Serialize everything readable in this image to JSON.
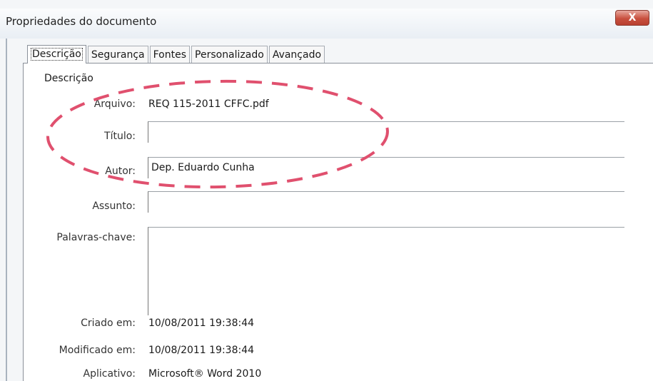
{
  "window": {
    "title": "Propriedades do documento",
    "close_label": "X"
  },
  "tabs": [
    {
      "label": "Descrição",
      "active": true
    },
    {
      "label": "Segurança",
      "active": false
    },
    {
      "label": "Fontes",
      "active": false
    },
    {
      "label": "Personalizado",
      "active": false
    },
    {
      "label": "Avançado",
      "active": false
    }
  ],
  "description": {
    "section_label": "Descrição",
    "fields": {
      "arquivo": {
        "label": "Arquivo:",
        "value": "REQ 115-2011 CFFC.pdf"
      },
      "titulo": {
        "label": "Título:",
        "value": ""
      },
      "autor": {
        "label": "Autor:",
        "value": "Dep. Eduardo Cunha"
      },
      "assunto": {
        "label": "Assunto:",
        "value": ""
      },
      "palavras_chave": {
        "label": "Palavras-chave:",
        "value": ""
      },
      "criado_em": {
        "label": "Criado em:",
        "value": "10/08/2011 19:38:44"
      },
      "modificado_em": {
        "label": "Modificado em:",
        "value": "10/08/2011 19:38:44"
      },
      "aplicativo": {
        "label": "Aplicativo:",
        "value": "Microsoft® Word 2010"
      }
    }
  },
  "colors": {
    "annotation": "#e0506e",
    "close_button": "#c9503f"
  }
}
